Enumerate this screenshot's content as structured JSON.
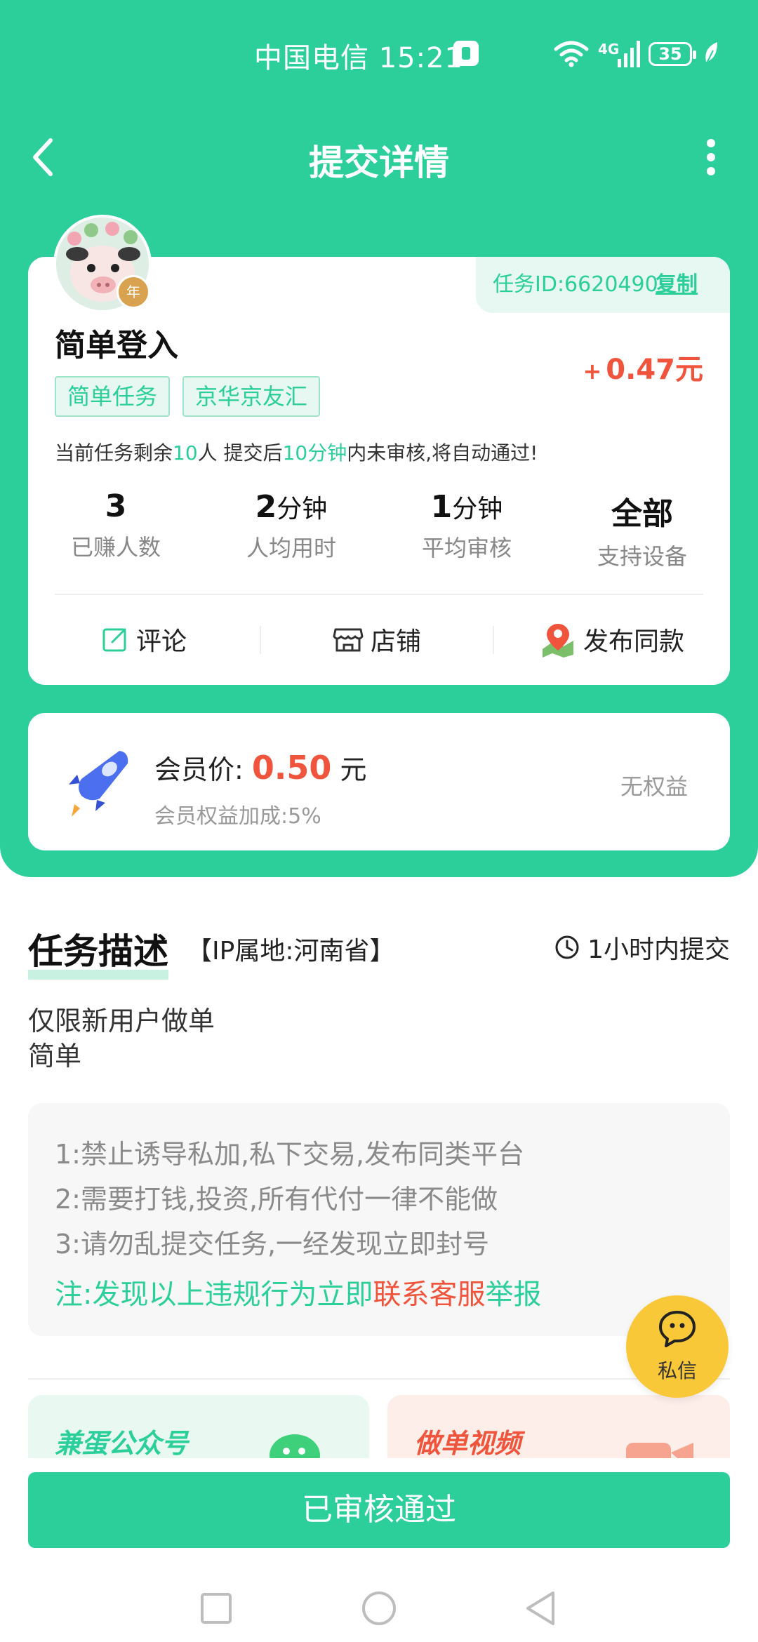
{
  "status_bar": {
    "carrier_time": "中国电信 15:21",
    "network": "4G",
    "battery": "35"
  },
  "nav": {
    "title": "提交详情"
  },
  "task": {
    "id_label": "任务ID:6620490",
    "copy_label": "复制",
    "name": "简单登入",
    "reward": "0.47元",
    "reward_prefix": "+",
    "tags": [
      "简单任务",
      "京华京友汇"
    ],
    "notice": {
      "part1": "当前任务剩余",
      "remaining": "10",
      "part2": "人  提交后",
      "minutes": "10分钟",
      "part3": "内未审核,将自动通过!"
    },
    "stats": [
      {
        "value": "3",
        "unit": "",
        "label": "已赚人数"
      },
      {
        "value": "2",
        "unit": "分钟",
        "label": "人均用时"
      },
      {
        "value": "1",
        "unit": "分钟",
        "label": "平均审核"
      },
      {
        "value": "全部",
        "unit": "",
        "label": "支持设备"
      }
    ],
    "actions": {
      "comment": "评论",
      "shop": "店铺",
      "publish_same": "发布同款"
    }
  },
  "member": {
    "label": "会员价:",
    "price": "0.50",
    "unit": "元",
    "sub": "会员权益加成:5%",
    "right": "无权益"
  },
  "section": {
    "title": "任务描述",
    "ip": "【IP属地:河南省】",
    "deadline": "1小时内提交"
  },
  "description": {
    "line1": "仅限新用户做单",
    "line2": "简单"
  },
  "rules": {
    "items": [
      "1:禁止诱导私加,私下交易,发布同类平台",
      "2:需要打钱,投资,所有代付一律不能做",
      "3:请勿乱提交任务,一经发现立即封号"
    ],
    "note_part1": "注:发现以上违规行为立即",
    "note_link": "联系客服",
    "note_part2": "举报"
  },
  "chat": {
    "label": "私信"
  },
  "promos": {
    "left": "兼蛋公众号",
    "right": "做单视频"
  },
  "bottom": {
    "approved": "已审核通过"
  },
  "colors": {
    "primary": "#2ccf9a",
    "price": "#f0543c",
    "chat_fab": "#f8c839"
  }
}
